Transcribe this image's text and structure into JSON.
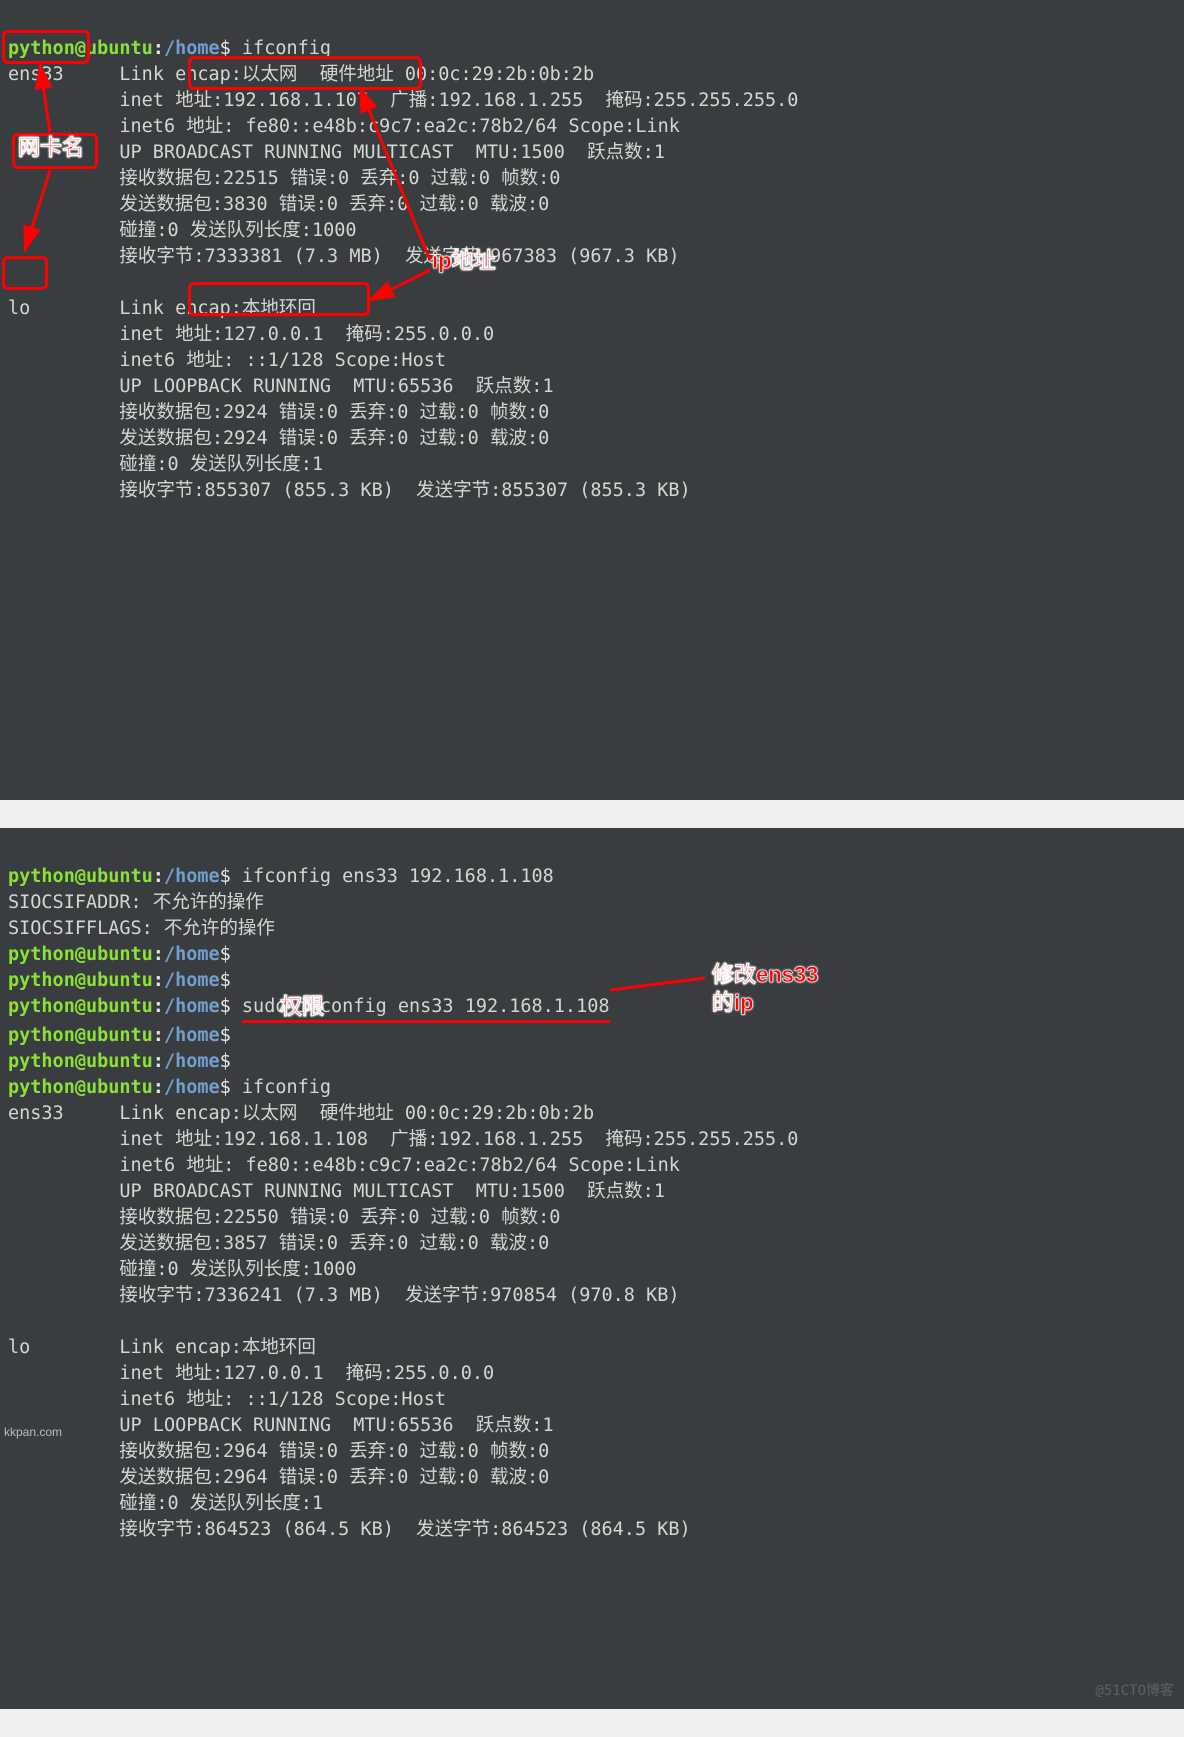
{
  "prompt": {
    "user": "python",
    "at": "@",
    "host": "ubuntu",
    "colon": ":",
    "path": "/home",
    "dollar": "$"
  },
  "top": {
    "cmd1": "ifconfig",
    "ens33": {
      "name": "ens33",
      "link": "Link encap:以太网  硬件地址 00:0c:29:2b:0b:2b",
      "inet_pre": "inet ",
      "inet_hi": "地址:192.168.1.107",
      "inet_post": "  广播:192.168.1.255  掩码:255.255.255.0",
      "inet6": "inet6 地址: fe80::e48b:c9c7:ea2c:78b2/64 Scope:Link",
      "flags": "UP BROADCAST RUNNING MULTICAST  MTU:1500  跃点数:1",
      "rxp": "接收数据包:22515 错误:0 丢弃:0 过载:0 帧数:0",
      "txp": "发送数据包:3830 错误:0 丢弃:0 过载:0 载波:0",
      "coll": "碰撞:0 发送队列长度:1000",
      "bytes": "接收字节:7333381 (7.3 MB)  发送字节:967383 (967.3 KB)"
    },
    "lo": {
      "name": "lo",
      "link": "Link encap:本地环回",
      "inet_pre": "inet ",
      "inet_hi": "地址:127.0.0.1",
      "inet_post": "  掩码:255.0.0.0",
      "inet6": "inet6 地址: ::1/128 Scope:Host",
      "flags": "UP LOOPBACK RUNNING  MTU:65536  跃点数:1",
      "rxp": "接收数据包:2924 错误:0 丢弃:0 过载:0 帧数:0",
      "txp": "发送数据包:2924 错误:0 丢弃:0 过载:0 载波:0",
      "coll": "碰撞:0 发送队列长度:1",
      "bytes": "接收字节:855307 (855.3 KB)  发送字节:855307 (855.3 KB)"
    },
    "anno": {
      "netcard": "网卡名",
      "ipaddr": "ip地址"
    }
  },
  "bottom": {
    "cmd1": "ifconfig ens33 192.168.1.108",
    "err1": "SIOCSIFADDR: 不允许的操作",
    "err2": "SIOCSIFFLAGS: 不允许的操作",
    "cmd_sudo_pre": "sudo ",
    "cmd_sudo_body": "ifconfig ens33 192.168.1.108",
    "cmd2": "ifconfig",
    "ens33": {
      "name": "ens33",
      "link": "Link encap:以太网  硬件地址 00:0c:29:2b:0b:2b",
      "inet": "inet 地址:192.168.1.108  广播:192.168.1.255  掩码:255.255.255.0",
      "inet6": "inet6 地址: fe80::e48b:c9c7:ea2c:78b2/64 Scope:Link",
      "flags": "UP BROADCAST RUNNING MULTICAST  MTU:1500  跃点数:1",
      "rxp": "接收数据包:22550 错误:0 丢弃:0 过载:0 帧数:0",
      "txp": "发送数据包:3857 错误:0 丢弃:0 过载:0 载波:0",
      "coll": "碰撞:0 发送队列长度:1000",
      "bytes": "接收字节:7336241 (7.3 MB)  发送字节:970854 (970.8 KB)"
    },
    "lo": {
      "name": "lo",
      "link": "Link encap:本地环回",
      "inet": "inet 地址:127.0.0.1  掩码:255.0.0.0",
      "inet6": "inet6 地址: ::1/128 Scope:Host",
      "flags": "UP LOOPBACK RUNNING  MTU:65536  跃点数:1",
      "rxp": "接收数据包:2964 错误:0 丢弃:0 过载:0 帧数:0",
      "txp": "发送数据包:2964 错误:0 丢弃:0 过载:0 载波:0",
      "coll": "碰撞:0 发送队列长度:1",
      "bytes": "接收字节:864523 (864.5 KB)  发送字节:864523 (864.5 KB)"
    },
    "anno": {
      "perm": "权限",
      "change1": "修改ens33",
      "change2": "的ip"
    },
    "wm": "@51CTO博客"
  },
  "footer": "kkpan.com"
}
